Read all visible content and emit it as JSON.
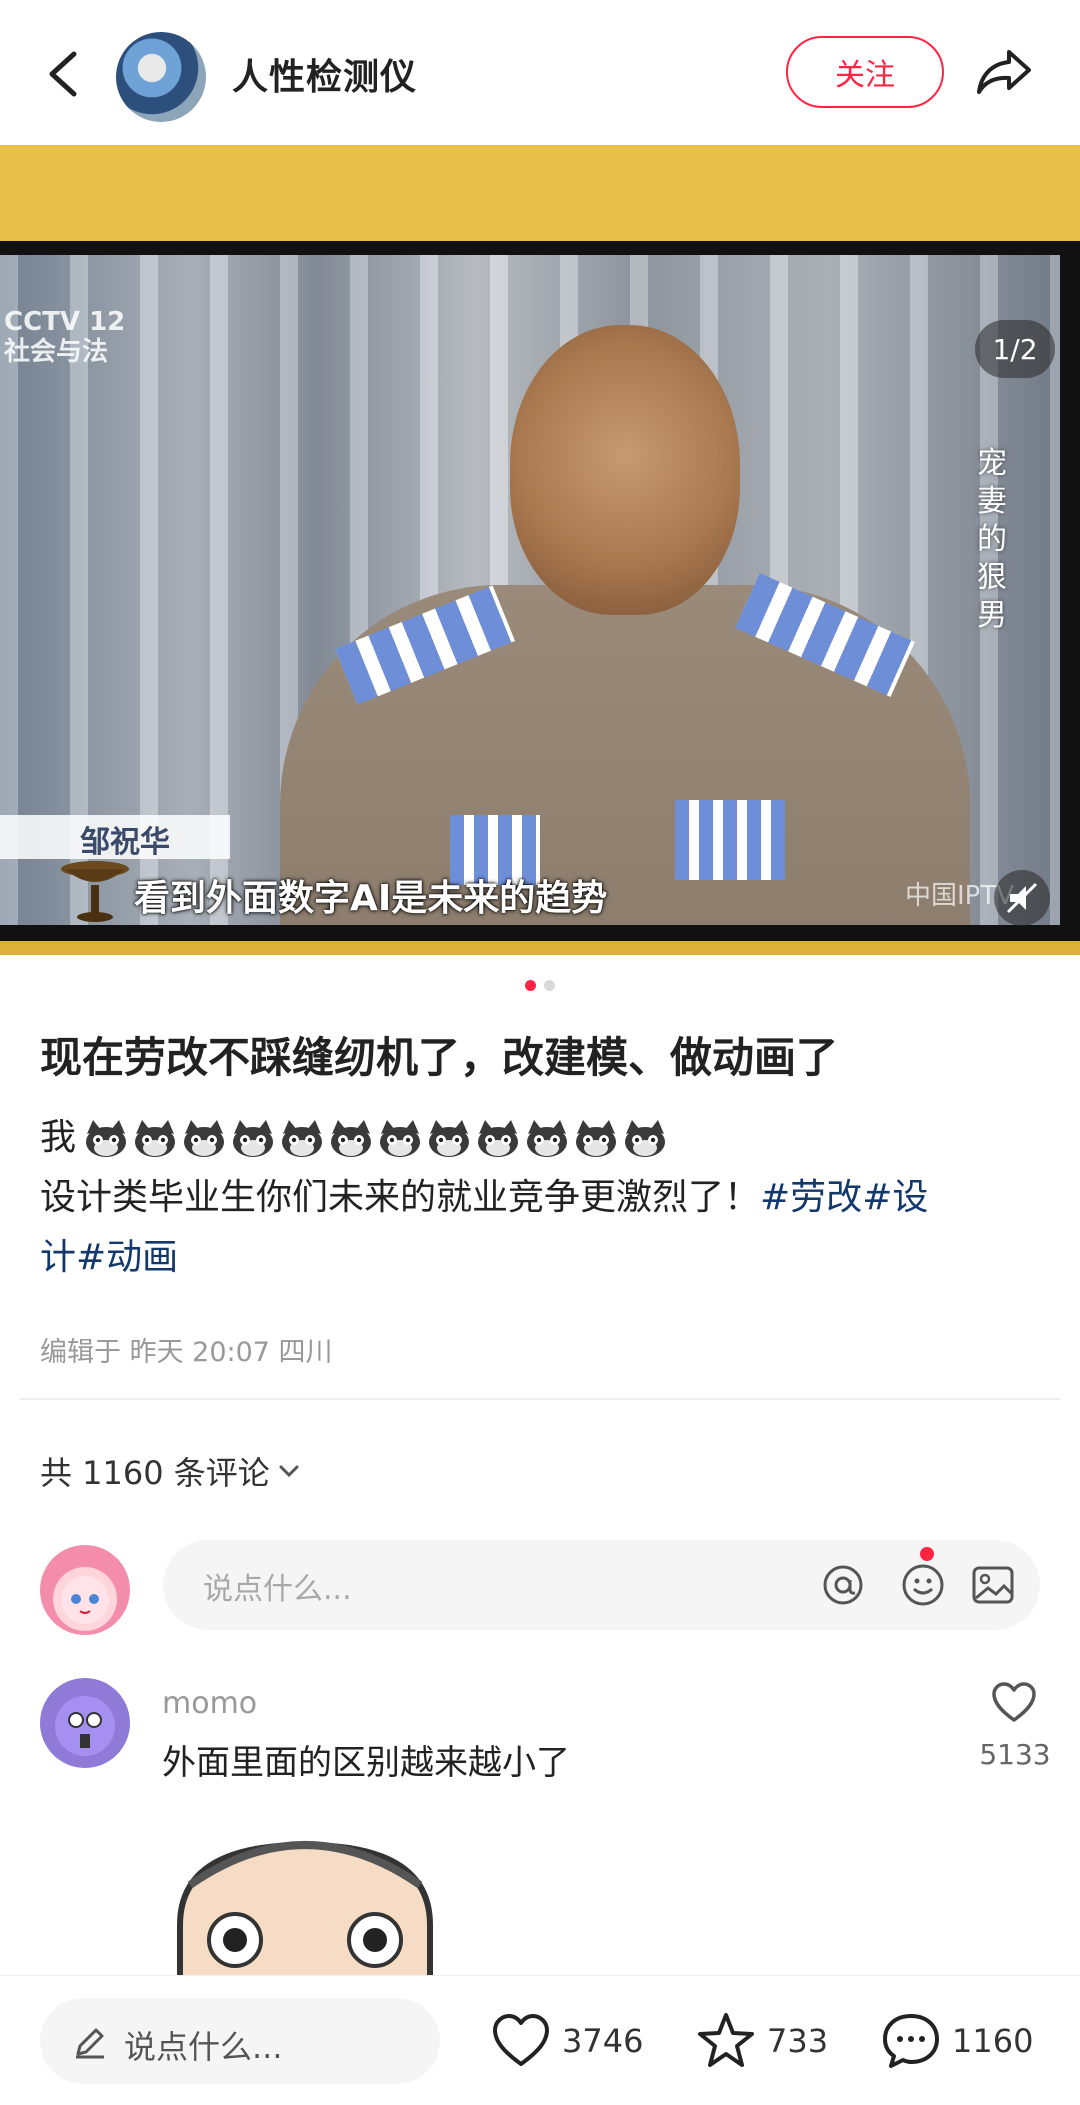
{
  "header": {
    "author_name": "人性检测仪",
    "follow_label": "关注"
  },
  "media": {
    "page_indicator": "1/2",
    "channel_logo": "CCTV 12\n社会与法",
    "vertical_caption": "宠\n妻\n的\n狠\n男",
    "name_label": "邹祝华",
    "subtitle": "看到外面数字AI是未来的趋势",
    "watermark": "中国IPTV",
    "slide_count": 2,
    "active_slide": 1
  },
  "post": {
    "title": "现在劳改不踩缝纫机了，改建模、做动画了",
    "emoji_prefix": "我",
    "emoji_count": 12,
    "body_line": "设计类毕业生你们未来的就业竞争更激烈了！",
    "tags": [
      "#劳改",
      "#设",
      "计#动画"
    ],
    "meta": "编辑于 昨天 20:07 四川"
  },
  "comments": {
    "count_label": "共 1160 条评论",
    "input_placeholder": "说点什么...",
    "items": [
      {
        "user": "momo",
        "text": "外面里面的区别越来越小了",
        "likes": "5133"
      }
    ]
  },
  "bottom_bar": {
    "input_placeholder": "说点什么...",
    "likes": "3746",
    "stars": "733",
    "comments": "1160"
  },
  "colors": {
    "accent": "#ff2442",
    "tag": "#13386c"
  }
}
